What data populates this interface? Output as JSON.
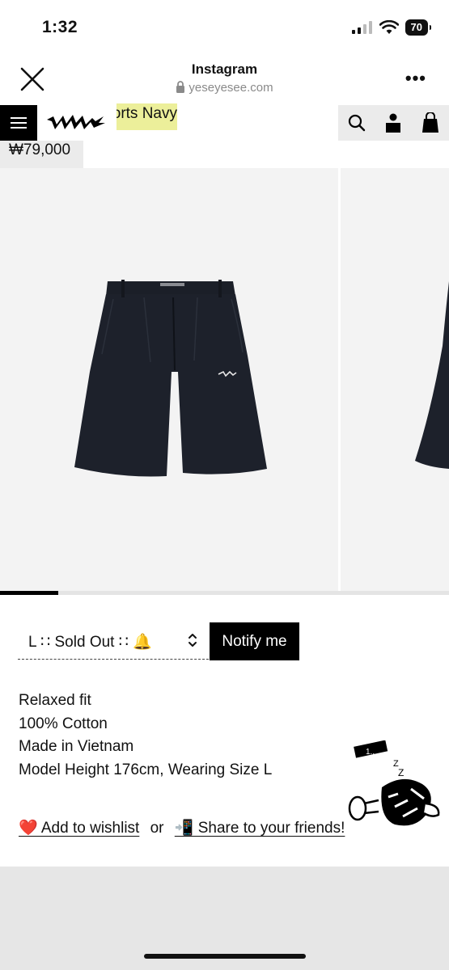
{
  "status_bar": {
    "time": "1:32",
    "battery": "70"
  },
  "browser": {
    "title": "Instagram",
    "url": "yeseyesee.com"
  },
  "product": {
    "title": "Pleated Shorts Navy",
    "price": "₩79,000",
    "gallery_progress": 0.13,
    "size_option": "L ∷ Sold Out ∷ 🔔",
    "notify_label": "Notify me",
    "details": [
      "Relaxed fit",
      "100% Cotton",
      "Made in Vietnam",
      "Model Height 176cm, Wearing Size L"
    ],
    "wishlist_label": "❤️ Add to wishlist",
    "or_label": "or",
    "share_label": "📲 Share to your friends!",
    "badge_text": "1.."
  },
  "icons": [
    "close-icon",
    "lock-icon",
    "more-icon",
    "menu-icon",
    "search-icon",
    "account-icon",
    "bag-icon",
    "chevron-updown-icon"
  ],
  "colors": {
    "title_highlight": "#ecef9a",
    "nav_gray": "#ebebeb",
    "shorts_navy": "#1d212b",
    "notify_bg": "#000000"
  }
}
